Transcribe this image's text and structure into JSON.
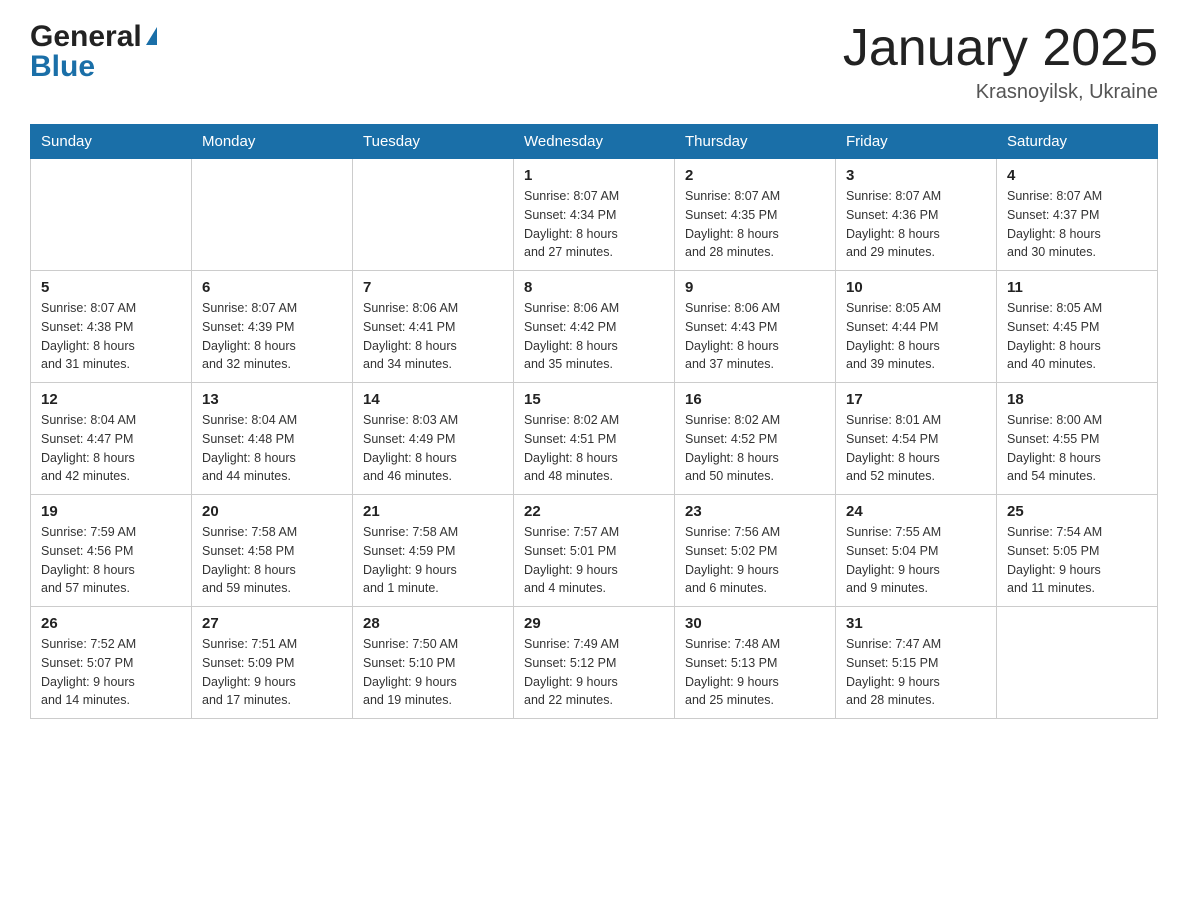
{
  "header": {
    "logo_general": "General",
    "logo_blue": "Blue",
    "month_title": "January 2025",
    "location": "Krasnoyilsk, Ukraine"
  },
  "days_of_week": [
    "Sunday",
    "Monday",
    "Tuesday",
    "Wednesday",
    "Thursday",
    "Friday",
    "Saturday"
  ],
  "weeks": [
    {
      "days": [
        {
          "number": "",
          "info": ""
        },
        {
          "number": "",
          "info": ""
        },
        {
          "number": "",
          "info": ""
        },
        {
          "number": "1",
          "info": "Sunrise: 8:07 AM\nSunset: 4:34 PM\nDaylight: 8 hours\nand 27 minutes."
        },
        {
          "number": "2",
          "info": "Sunrise: 8:07 AM\nSunset: 4:35 PM\nDaylight: 8 hours\nand 28 minutes."
        },
        {
          "number": "3",
          "info": "Sunrise: 8:07 AM\nSunset: 4:36 PM\nDaylight: 8 hours\nand 29 minutes."
        },
        {
          "number": "4",
          "info": "Sunrise: 8:07 AM\nSunset: 4:37 PM\nDaylight: 8 hours\nand 30 minutes."
        }
      ]
    },
    {
      "days": [
        {
          "number": "5",
          "info": "Sunrise: 8:07 AM\nSunset: 4:38 PM\nDaylight: 8 hours\nand 31 minutes."
        },
        {
          "number": "6",
          "info": "Sunrise: 8:07 AM\nSunset: 4:39 PM\nDaylight: 8 hours\nand 32 minutes."
        },
        {
          "number": "7",
          "info": "Sunrise: 8:06 AM\nSunset: 4:41 PM\nDaylight: 8 hours\nand 34 minutes."
        },
        {
          "number": "8",
          "info": "Sunrise: 8:06 AM\nSunset: 4:42 PM\nDaylight: 8 hours\nand 35 minutes."
        },
        {
          "number": "9",
          "info": "Sunrise: 8:06 AM\nSunset: 4:43 PM\nDaylight: 8 hours\nand 37 minutes."
        },
        {
          "number": "10",
          "info": "Sunrise: 8:05 AM\nSunset: 4:44 PM\nDaylight: 8 hours\nand 39 minutes."
        },
        {
          "number": "11",
          "info": "Sunrise: 8:05 AM\nSunset: 4:45 PM\nDaylight: 8 hours\nand 40 minutes."
        }
      ]
    },
    {
      "days": [
        {
          "number": "12",
          "info": "Sunrise: 8:04 AM\nSunset: 4:47 PM\nDaylight: 8 hours\nand 42 minutes."
        },
        {
          "number": "13",
          "info": "Sunrise: 8:04 AM\nSunset: 4:48 PM\nDaylight: 8 hours\nand 44 minutes."
        },
        {
          "number": "14",
          "info": "Sunrise: 8:03 AM\nSunset: 4:49 PM\nDaylight: 8 hours\nand 46 minutes."
        },
        {
          "number": "15",
          "info": "Sunrise: 8:02 AM\nSunset: 4:51 PM\nDaylight: 8 hours\nand 48 minutes."
        },
        {
          "number": "16",
          "info": "Sunrise: 8:02 AM\nSunset: 4:52 PM\nDaylight: 8 hours\nand 50 minutes."
        },
        {
          "number": "17",
          "info": "Sunrise: 8:01 AM\nSunset: 4:54 PM\nDaylight: 8 hours\nand 52 minutes."
        },
        {
          "number": "18",
          "info": "Sunrise: 8:00 AM\nSunset: 4:55 PM\nDaylight: 8 hours\nand 54 minutes."
        }
      ]
    },
    {
      "days": [
        {
          "number": "19",
          "info": "Sunrise: 7:59 AM\nSunset: 4:56 PM\nDaylight: 8 hours\nand 57 minutes."
        },
        {
          "number": "20",
          "info": "Sunrise: 7:58 AM\nSunset: 4:58 PM\nDaylight: 8 hours\nand 59 minutes."
        },
        {
          "number": "21",
          "info": "Sunrise: 7:58 AM\nSunset: 4:59 PM\nDaylight: 9 hours\nand 1 minute."
        },
        {
          "number": "22",
          "info": "Sunrise: 7:57 AM\nSunset: 5:01 PM\nDaylight: 9 hours\nand 4 minutes."
        },
        {
          "number": "23",
          "info": "Sunrise: 7:56 AM\nSunset: 5:02 PM\nDaylight: 9 hours\nand 6 minutes."
        },
        {
          "number": "24",
          "info": "Sunrise: 7:55 AM\nSunset: 5:04 PM\nDaylight: 9 hours\nand 9 minutes."
        },
        {
          "number": "25",
          "info": "Sunrise: 7:54 AM\nSunset: 5:05 PM\nDaylight: 9 hours\nand 11 minutes."
        }
      ]
    },
    {
      "days": [
        {
          "number": "26",
          "info": "Sunrise: 7:52 AM\nSunset: 5:07 PM\nDaylight: 9 hours\nand 14 minutes."
        },
        {
          "number": "27",
          "info": "Sunrise: 7:51 AM\nSunset: 5:09 PM\nDaylight: 9 hours\nand 17 minutes."
        },
        {
          "number": "28",
          "info": "Sunrise: 7:50 AM\nSunset: 5:10 PM\nDaylight: 9 hours\nand 19 minutes."
        },
        {
          "number": "29",
          "info": "Sunrise: 7:49 AM\nSunset: 5:12 PM\nDaylight: 9 hours\nand 22 minutes."
        },
        {
          "number": "30",
          "info": "Sunrise: 7:48 AM\nSunset: 5:13 PM\nDaylight: 9 hours\nand 25 minutes."
        },
        {
          "number": "31",
          "info": "Sunrise: 7:47 AM\nSunset: 5:15 PM\nDaylight: 9 hours\nand 28 minutes."
        },
        {
          "number": "",
          "info": ""
        }
      ]
    }
  ]
}
